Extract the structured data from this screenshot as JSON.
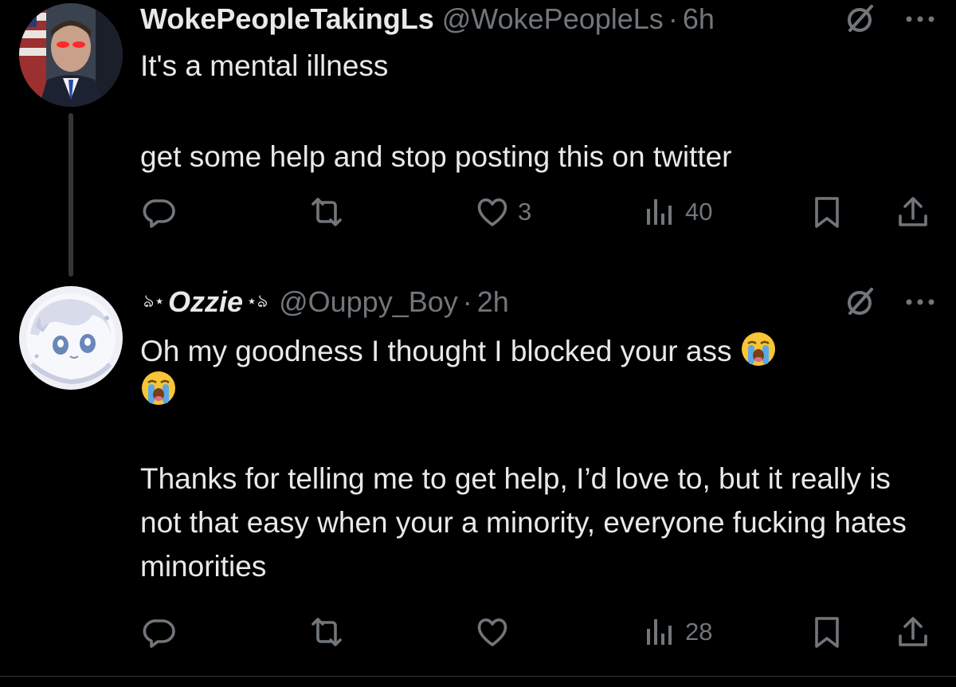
{
  "tweets": [
    {
      "display_name": "WokePeopleTakingLs",
      "handle": "@WokePeopleLs",
      "separator": "·",
      "time": "6h",
      "lines": [
        "It's a mental illness",
        "",
        "get some help and stop posting this on twitter"
      ],
      "stats": {
        "replies": "",
        "reposts": "",
        "likes": "3",
        "views": "40"
      }
    },
    {
      "display_name_deco_left": "ঌ⋆",
      "display_name": "Ozzie",
      "display_name_deco_right": "⋆ঌ",
      "handle": "@Ouppy_Boy",
      "separator": "·",
      "time": "2h",
      "line1": "Oh my goodness I thought I blocked your ass",
      "paragraph2": "Thanks for telling me to get help, I’d love to, but it really is not that easy when your a minority, everyone fucking hates minorities",
      "stats": {
        "replies": "",
        "reposts": "",
        "likes": "",
        "views": "28"
      }
    }
  ],
  "icons": {
    "reply": "reply-icon",
    "repost": "repost-icon",
    "like": "heart-icon",
    "views": "views-icon",
    "bookmark": "bookmark-icon",
    "share": "share-icon",
    "grok": "grok-icon",
    "more": "more-icon",
    "emoji": "loudly-crying-face-emoji"
  },
  "colors": {
    "background": "#000000",
    "text_primary": "#e7e9ea",
    "text_secondary": "#71767b",
    "thread_line": "#333639"
  }
}
